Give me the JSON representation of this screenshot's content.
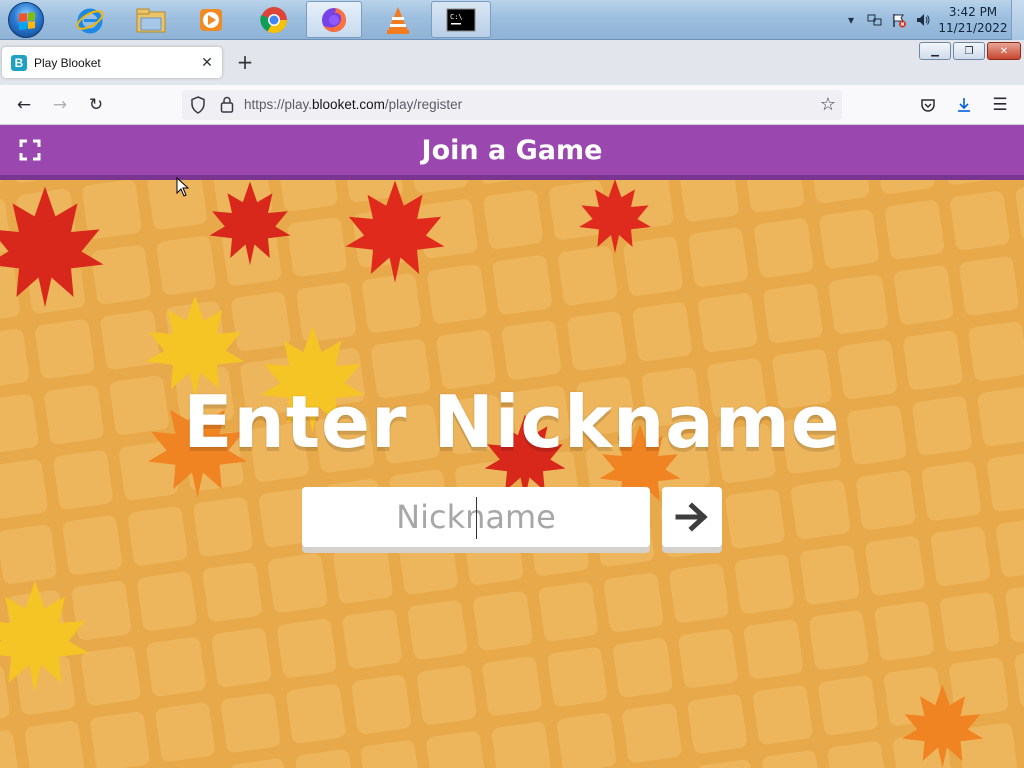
{
  "taskbar": {
    "clock_time": "3:42 PM",
    "clock_date": "11/21/2022",
    "apps": [
      "internet-explorer-icon",
      "file-explorer-icon",
      "media-player-icon",
      "chrome-icon",
      "firefox-icon",
      "vlc-icon",
      "cmd-icon"
    ]
  },
  "browser": {
    "tab_title": "Play Blooket",
    "tab_favicon": "B",
    "url_prefix": "https://play.",
    "url_host": "blooket.com",
    "url_path": "/play/register"
  },
  "page": {
    "header_title": "Join a Game",
    "heading": "Enter Nickname",
    "nickname_placeholder": "Nickname",
    "nickname_value": ""
  },
  "colors": {
    "header_purple": "#9a48b0",
    "background_orange": "#e8a94a",
    "white": "#ffffff"
  }
}
